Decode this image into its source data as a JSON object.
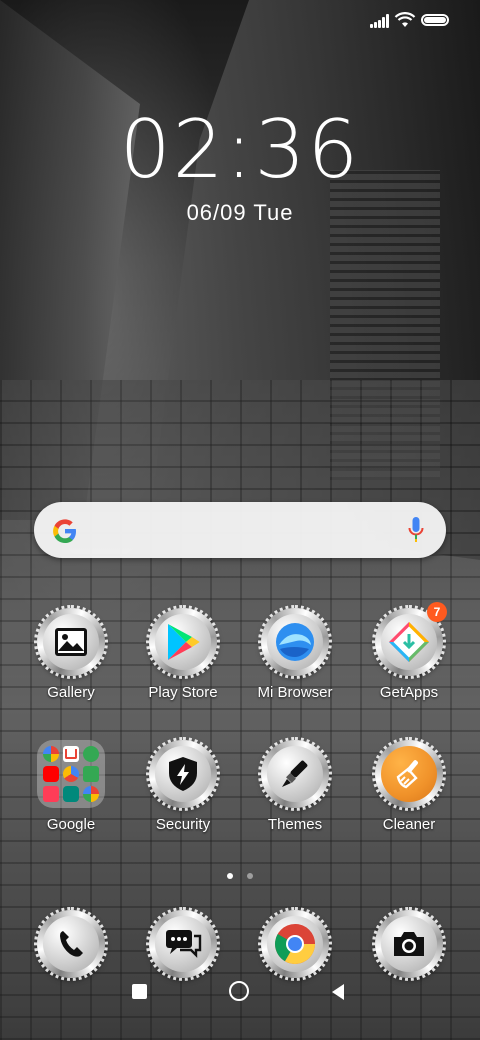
{
  "clock": {
    "time": "02:36",
    "date": "06/09 Tue"
  },
  "status_bar": {
    "signal_icon": "signal-icon",
    "wifi_icon": "wifi-icon",
    "battery_icon": "battery-icon"
  },
  "search": {
    "logo_icon": "google-g-icon",
    "mic_icon": "mic-icon"
  },
  "apps_row1": [
    {
      "label": "Gallery",
      "icon": "gallery-icon"
    },
    {
      "label": "Play Store",
      "icon": "play-store-icon"
    },
    {
      "label": "Mi Browser",
      "icon": "mi-browser-icon"
    },
    {
      "label": "GetApps",
      "icon": "getapps-icon",
      "badge": "7"
    }
  ],
  "apps_row2": [
    {
      "label": "Google",
      "icon": "google-folder-icon"
    },
    {
      "label": "Security",
      "icon": "security-icon"
    },
    {
      "label": "Themes",
      "icon": "themes-icon"
    },
    {
      "label": "Cleaner",
      "icon": "cleaner-icon"
    }
  ],
  "dock": [
    {
      "icon": "phone-icon"
    },
    {
      "icon": "messages-icon"
    },
    {
      "icon": "chrome-icon"
    },
    {
      "icon": "camera-icon"
    }
  ],
  "page_indicator": {
    "pages": 2,
    "current": 1
  },
  "nav_bar": {
    "recents": "recents-icon",
    "home": "home-icon",
    "back": "back-icon"
  },
  "colors": {
    "badge": "#ff5a1f",
    "cleaner": "#f0922a",
    "accent_text": "#ffffff"
  }
}
